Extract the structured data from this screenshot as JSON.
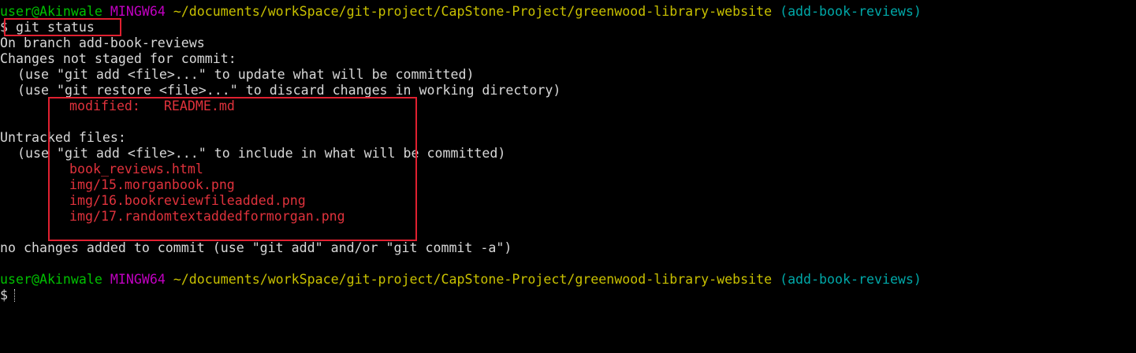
{
  "prompt": {
    "user_host": "user@Akinwale",
    "system": "MINGW64",
    "path": "~/documents/workSpace/git-project/CapStone-Project/greenwood-library-website",
    "branch": "(add-book-reviews)",
    "symbol": "$"
  },
  "command": "git status",
  "output": {
    "on_branch": "On branch add-book-reviews",
    "not_staged_header": "Changes not staged for commit:",
    "hint_add": "(use \"git add <file>...\" to update what will be committed)",
    "hint_restore": "(use \"git restore <file>...\" to discard changes in working directory)",
    "modified_label": "modified:",
    "modified_file": "README.md",
    "untracked_header": "Untracked files:",
    "hint_untracked": "(use \"git add <file>...\" to include in what will be committed)",
    "untracked_files": [
      "book_reviews.html",
      "img/15.morganbook.png",
      "img/16.bookreviewfileadded.png",
      "img/17.randomtextaddedformorgan.png"
    ],
    "summary": "no changes added to commit (use \"git add\" and/or \"git commit -a\")"
  },
  "colors": {
    "background": "#000000",
    "text": "#d8d8d8",
    "user_host": "#00c000",
    "system": "#c000c0",
    "path": "#c8c000",
    "branch": "#00a8a8",
    "file_changes": "#e0323c",
    "annotation_box": "#e02030"
  }
}
